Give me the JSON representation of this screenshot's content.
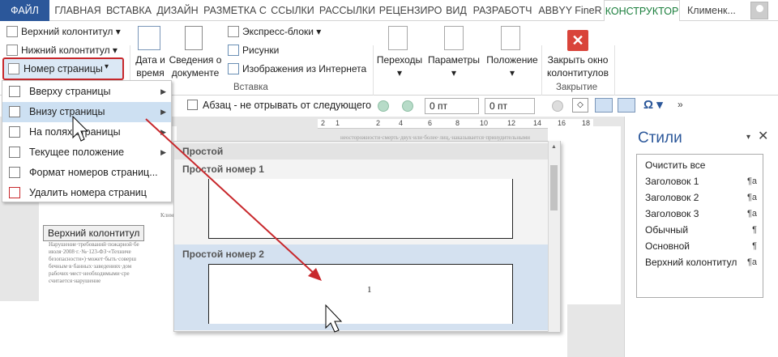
{
  "tabs": [
    {
      "label": "ФАЙЛ"
    },
    {
      "label": "ГЛАВНАЯ"
    },
    {
      "label": "ВСТАВКА"
    },
    {
      "label": "ДИЗАЙН"
    },
    {
      "label": "РАЗМЕТКА С"
    },
    {
      "label": "ССЫЛКИ"
    },
    {
      "label": "РАССЫЛКИ"
    },
    {
      "label": "РЕЦЕНЗИРО"
    },
    {
      "label": "ВИД"
    },
    {
      "label": "РАЗРАБОТЧ"
    },
    {
      "label": "ABBYY FineR"
    },
    {
      "label": "КОНСТРУКТОР"
    },
    {
      "label": "Клименк..."
    }
  ],
  "ribbon": {
    "header_footer": {
      "header": "Верхний колонтитул",
      "footer": "Нижний колонтитул",
      "page_number": "Номер страницы"
    },
    "date_time": "Дата и\nвремя",
    "doc_info": "Сведения о\nдокументе",
    "express_blocks": "Экспресс-блоки",
    "pictures": "Рисунки",
    "online_pictures": "Изображения из Интернета",
    "insert_group": "Вставка",
    "navigation": "Переходы",
    "options": "Параметры",
    "position": "Положение",
    "close": "Закрыть окно\nколонтитулов",
    "close_group": "Закрытие"
  },
  "format_bar": {
    "keep_with_next": "Абзац - не отрывать от следующего",
    "spin1": "0 пт",
    "spin2": "0 пт"
  },
  "ruler": [
    "2",
    "1",
    "2",
    "4",
    "6",
    "8",
    "10",
    "12",
    "14",
    "16",
    "18"
  ],
  "page_number_menu": [
    {
      "label": "Вверху страницы",
      "submenu": true
    },
    {
      "label": "Внизу страницы",
      "submenu": true,
      "highlighted": true
    },
    {
      "label": "На полях страницы",
      "submenu": true
    },
    {
      "label": "Текущее положение",
      "submenu": true
    },
    {
      "label": "Формат номеров страниц..."
    },
    {
      "label": "Удалить номера страниц"
    }
  ],
  "gallery": {
    "section": "Простой",
    "items": [
      {
        "label": "Простой номер 1"
      },
      {
        "label": "Простой номер 2"
      }
    ],
    "number_marker": "1"
  },
  "doc": {
    "header_label": "Верхний колонтитул",
    "title_fragment": "Клим",
    "lines": [
      "Нарушение·требований·пожарной·бе",
      "июля·2008·г.·№·123-ФЗ·«Техниче",
      "безопасности»)·может·быть·соверш",
      "бечным·в·банных·заведениях·дом",
      "рабочих·мест·необходимыми·сре",
      "считается·нарушение"
    ],
    "top_fragment": "неосторожности·смерть·двух·или·более·лиц,·наказывается·принудительными"
  },
  "styles_pane": {
    "title": "Стили",
    "items": [
      {
        "name": "Очистить все",
        "mark": ""
      },
      {
        "name": "Заголовок 1",
        "mark": "¶a"
      },
      {
        "name": "Заголовок 2",
        "mark": "¶a"
      },
      {
        "name": "Заголовок 3",
        "mark": "¶a"
      },
      {
        "name": "Обычный",
        "mark": "¶"
      },
      {
        "name": "Основной",
        "mark": "¶"
      },
      {
        "name": "Верхний колонтитул",
        "mark": "¶a"
      }
    ]
  },
  "colors": {
    "file_tab": "#2b579a",
    "active_tab": "#1a7e3c",
    "highlight_border": "#c8282c",
    "arrow": "#c8282c",
    "menu_highlight": "#cde0f2"
  }
}
